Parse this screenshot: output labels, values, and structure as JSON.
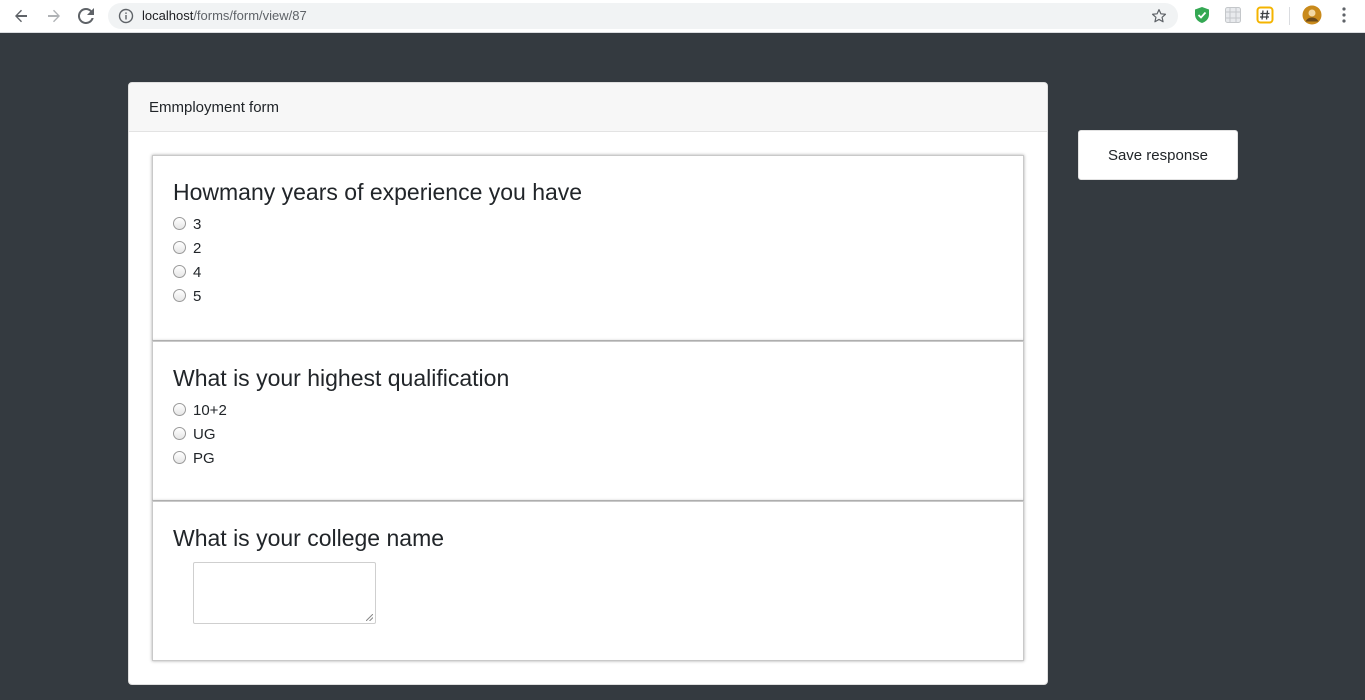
{
  "browser": {
    "url_host": "localhost",
    "url_path": "/forms/form/view/87"
  },
  "card": {
    "header": "Emmployment form"
  },
  "questions": [
    {
      "title": "Howmany years of experience you have",
      "options": [
        "3",
        "2",
        "4",
        "5"
      ]
    },
    {
      "title": "What is your highest qualification",
      "options": [
        "10+2",
        "UG",
        "PG"
      ]
    },
    {
      "title": "What is your college name",
      "answer": ""
    }
  ],
  "actions": {
    "save_label": "Save response"
  },
  "colors": {
    "page_background": "#343a40",
    "card_header_background": "#f7f7f7"
  }
}
